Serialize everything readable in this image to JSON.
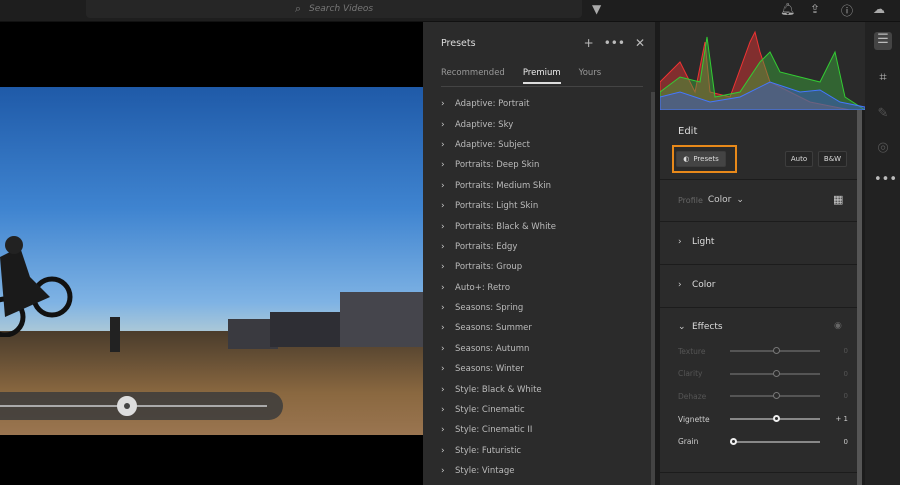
{
  "topbar": {
    "search_placeholder": "Search Videos"
  },
  "presets": {
    "title": "Presets",
    "tabs": [
      "Recommended",
      "Premium",
      "Yours"
    ],
    "active_tab": "Premium",
    "items": [
      "Adaptive: Portrait",
      "Adaptive: Sky",
      "Adaptive: Subject",
      "Portraits: Deep Skin",
      "Portraits: Medium Skin",
      "Portraits: Light Skin",
      "Portraits: Black & White",
      "Portraits: Edgy",
      "Portraits: Group",
      "Auto+: Retro",
      "Seasons: Spring",
      "Seasons: Summer",
      "Seasons: Autumn",
      "Seasons: Winter",
      "Style: Black & White",
      "Style: Cinematic",
      "Style: Cinematic II",
      "Style: Futuristic",
      "Style: Vintage"
    ]
  },
  "edit": {
    "title": "Edit",
    "presets_btn": "Presets",
    "auto_btn": "Auto",
    "bw_btn": "B&W",
    "profile_label": "Profile",
    "profile_value": "Color",
    "sections": {
      "light": "Light",
      "color": "Color",
      "effects": "Effects"
    },
    "sliders": [
      {
        "label": "Texture",
        "value": "0",
        "pos": 0.5
      },
      {
        "label": "Clarity",
        "value": "0",
        "pos": 0.5
      },
      {
        "label": "Dehaze",
        "value": "0",
        "pos": 0.5
      },
      {
        "label": "Vignette",
        "value": "+ 1",
        "pos": 0.505
      },
      {
        "label": "Grain",
        "value": "0",
        "pos": 0
      }
    ]
  },
  "colors": {
    "highlight": "#e8891a"
  }
}
